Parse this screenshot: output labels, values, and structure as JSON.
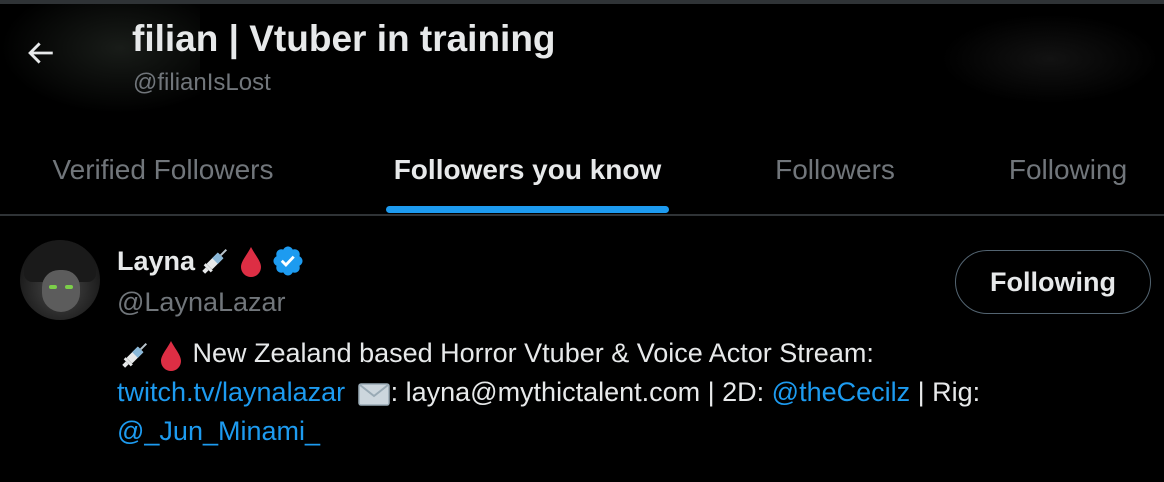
{
  "header": {
    "title": "filian | Vtuber in training",
    "handle": "@filianIsLost",
    "back_icon": "arrow-left-icon"
  },
  "tabs": [
    {
      "label": "Verified Followers",
      "active": false
    },
    {
      "label": "Followers you know",
      "active": true
    },
    {
      "label": "Followers",
      "active": false
    },
    {
      "label": "Following",
      "active": false
    }
  ],
  "user": {
    "display_name": "Layna",
    "name_emojis": [
      "syringe-emoji",
      "drop-of-blood-emoji"
    ],
    "verified": true,
    "handle": "@LaynaLazar",
    "follow_button_label": "Following",
    "bio": {
      "line1_text": " New Zealand based Horror Vtuber & Voice Actor Stream:",
      "link1": "twitch.tv/laynalazar",
      "envelope_emoji": "envelope-emoji",
      "middle_text": ": layna@mythictalent.com | 2D: ",
      "link2": "@theCecilz",
      "rig_text": " | Rig:",
      "link3": "@_Jun_Minami_"
    }
  },
  "colors": {
    "background": "#000000",
    "text_primary": "#e7e9ea",
    "text_secondary": "#71767b",
    "accent": "#1d9bf0",
    "border": "#2f3336"
  }
}
